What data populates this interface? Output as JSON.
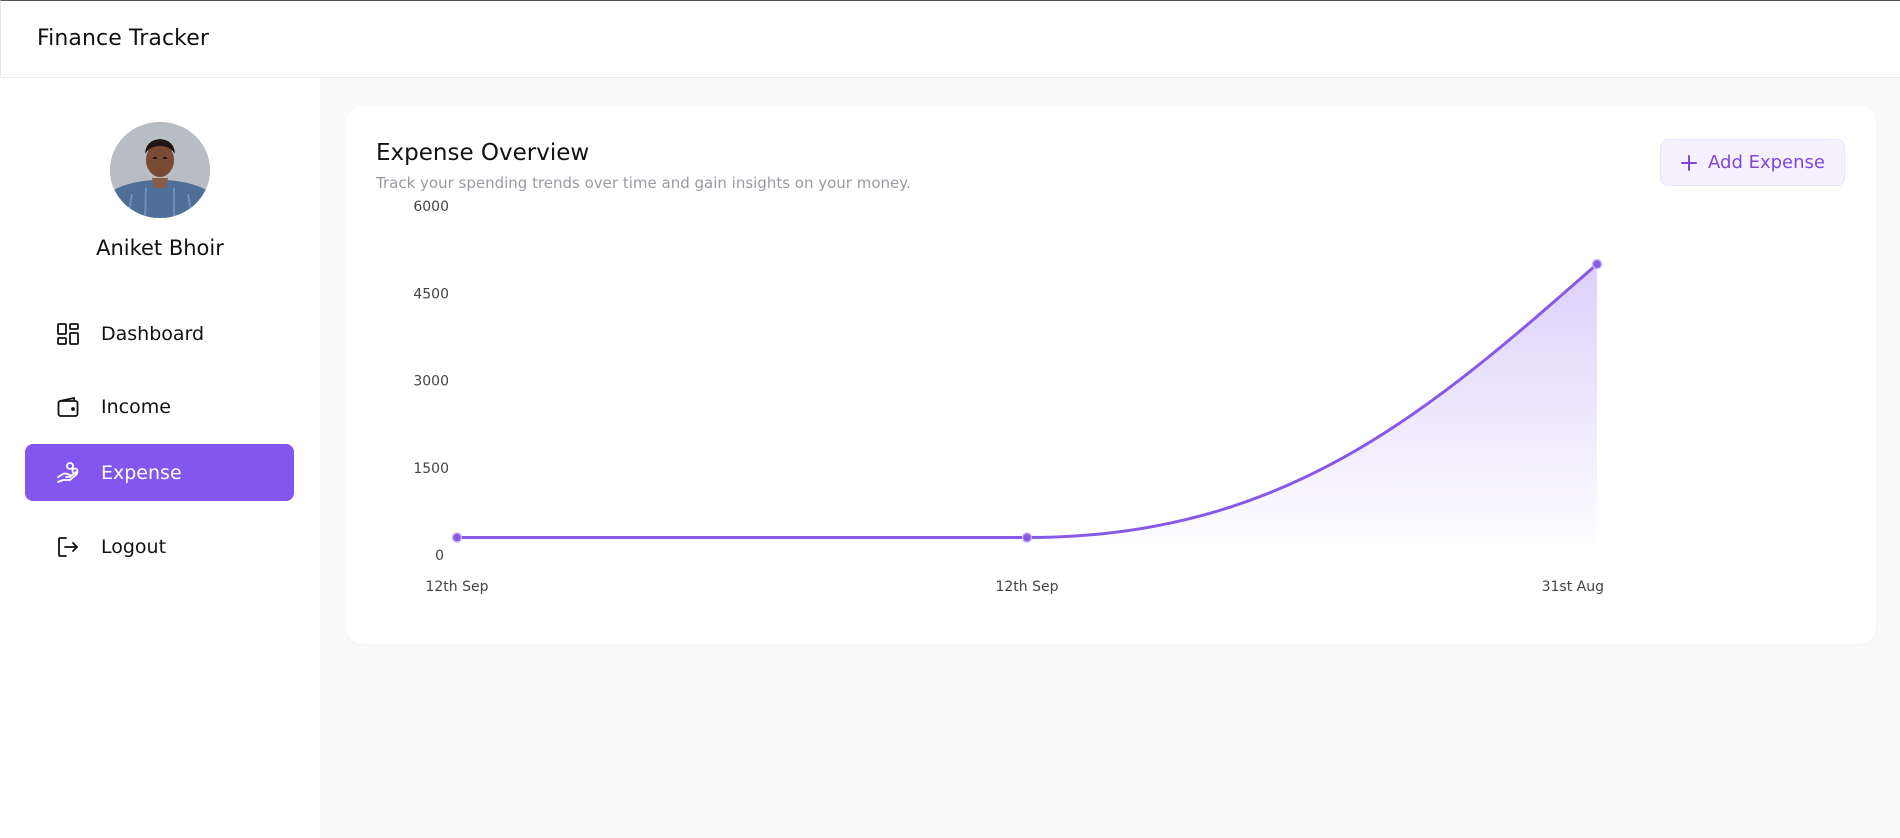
{
  "header": {
    "title": "Finance Tracker"
  },
  "sidebar": {
    "user_name": "Aniket Bhoir",
    "items": [
      {
        "label": "Dashboard",
        "icon": "dashboard-grid-icon",
        "active": false
      },
      {
        "label": "Income",
        "icon": "wallet-icon",
        "active": false
      },
      {
        "label": "Expense",
        "icon": "hand-coins-icon",
        "active": true
      },
      {
        "label": "Logout",
        "icon": "logout-icon",
        "active": false
      }
    ]
  },
  "overview": {
    "title": "Expense Overview",
    "subtitle": "Track your spending trends over time and gain insights on your money.",
    "add_button_label": "Add Expense"
  },
  "colors": {
    "accent": "#8356f0",
    "line": "#8659e6",
    "button_text": "#7d46dd"
  },
  "chart_data": {
    "type": "area",
    "x": [
      "12th Sep",
      "12th Sep",
      "31st Aug"
    ],
    "values": [
      300,
      300,
      5000
    ],
    "y_ticks": [
      0,
      1500,
      3000,
      4500,
      6000
    ],
    "ylim": [
      0,
      6000
    ],
    "grid": false,
    "title": "",
    "xlabel": "",
    "ylabel": ""
  }
}
